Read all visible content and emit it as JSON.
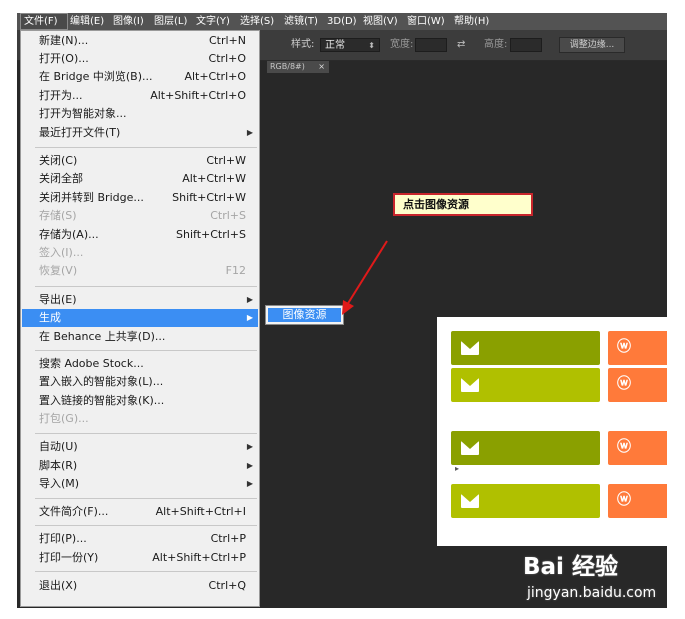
{
  "menubar": {
    "items": [
      {
        "label": "文件(F)"
      },
      {
        "label": "编辑(E)"
      },
      {
        "label": "图像(I)"
      },
      {
        "label": "图层(L)"
      },
      {
        "label": "文字(Y)"
      },
      {
        "label": "选择(S)"
      },
      {
        "label": "滤镜(T)"
      },
      {
        "label": "3D(D)"
      },
      {
        "label": "视图(V)"
      },
      {
        "label": "窗口(W)"
      },
      {
        "label": "帮助(H)"
      }
    ]
  },
  "options_bar": {
    "style_label": "样式:",
    "style_value": "正常",
    "width_label": "宽度:",
    "height_label": "高度:",
    "refine_button": "调整边缘..."
  },
  "document_tab": {
    "label": "RGB/8#)",
    "close": "×"
  },
  "file_menu": {
    "items": [
      {
        "label": "新建(N)...",
        "shortcut": "Ctrl+N"
      },
      {
        "label": "打开(O)...",
        "shortcut": "Ctrl+O"
      },
      {
        "label": "在 Bridge 中浏览(B)...",
        "shortcut": "Alt+Ctrl+O"
      },
      {
        "label": "打开为...",
        "shortcut": "Alt+Shift+Ctrl+O"
      },
      {
        "label": "打开为智能对象...",
        "shortcut": ""
      },
      {
        "label": "最近打开文件(T)",
        "shortcut": ""
      },
      {
        "label": "关闭(C)",
        "shortcut": "Ctrl+W"
      },
      {
        "label": "关闭全部",
        "shortcut": "Alt+Ctrl+W"
      },
      {
        "label": "关闭并转到 Bridge...",
        "shortcut": "Shift+Ctrl+W"
      },
      {
        "label": "存储(S)",
        "shortcut": "Ctrl+S"
      },
      {
        "label": "存储为(A)...",
        "shortcut": "Shift+Ctrl+S"
      },
      {
        "label": "签入(I)...",
        "shortcut": ""
      },
      {
        "label": "恢复(V)",
        "shortcut": "F12"
      },
      {
        "label": "导出(E)",
        "shortcut": ""
      },
      {
        "label": "生成",
        "shortcut": ""
      },
      {
        "label": "在 Behance 上共享(D)...",
        "shortcut": ""
      },
      {
        "label": "搜索 Adobe Stock...",
        "shortcut": ""
      },
      {
        "label": "置入嵌入的智能对象(L)...",
        "shortcut": ""
      },
      {
        "label": "置入链接的智能对象(K)...",
        "shortcut": ""
      },
      {
        "label": "打包(G)...",
        "shortcut": ""
      },
      {
        "label": "自动(U)",
        "shortcut": ""
      },
      {
        "label": "脚本(R)",
        "shortcut": ""
      },
      {
        "label": "导入(M)",
        "shortcut": ""
      },
      {
        "label": "文件简介(F)...",
        "shortcut": "Alt+Shift+Ctrl+I"
      },
      {
        "label": "打印(P)...",
        "shortcut": "Ctrl+P"
      },
      {
        "label": "打印一份(Y)",
        "shortcut": "Alt+Shift+Ctrl+P"
      },
      {
        "label": "退出(X)",
        "shortcut": "Ctrl+Q"
      }
    ]
  },
  "submenu": {
    "item": "图像资源"
  },
  "annotation": {
    "text": "点击图像资源",
    "border_color": "#c8252c",
    "fill": "#ffffcc"
  },
  "preview": {
    "accent_green_dark": "#8aa000",
    "accent_green_light": "#b0c000",
    "accent_orange": "#ff7a3a",
    "weibo_glyph": "ⓦ"
  },
  "watermark": {
    "logo": "Bai 经验",
    "url": "jingyan.baidu.com"
  }
}
